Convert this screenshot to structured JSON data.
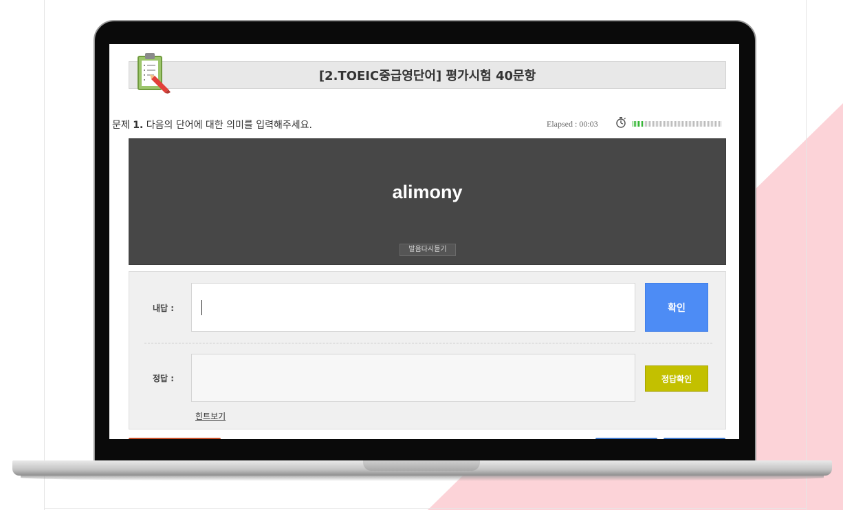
{
  "header": {
    "title": "[2.TOEIC중급영단어] 평가시험 40문항"
  },
  "question": {
    "prefix": "문제 ",
    "number": "1.",
    "instruction": " 다음의 단어에 대한 의미를 입력해주세요.",
    "elapsed": "Elapsed : 00:03",
    "time_progress_fraction": 0.12
  },
  "word_card": {
    "word": "alimony",
    "listen_again_label": "발음다시듣기"
  },
  "answer": {
    "my_answer_label": "내답 :",
    "my_answer_value": "",
    "confirm_label": "확인",
    "correct_label": "정답 :",
    "check_answer_label": "정답확인",
    "hint_label": "힌트보기"
  },
  "colors": {
    "confirm_button": "#4d8cf5",
    "check_button": "#c3c000",
    "word_panel": "#474747",
    "progress_fill": "#22b022",
    "decor_pink": "#fcd3d8"
  },
  "icons": {
    "title_icon": "clipboard-pencil-icon",
    "timer_icon": "stopwatch-icon"
  }
}
